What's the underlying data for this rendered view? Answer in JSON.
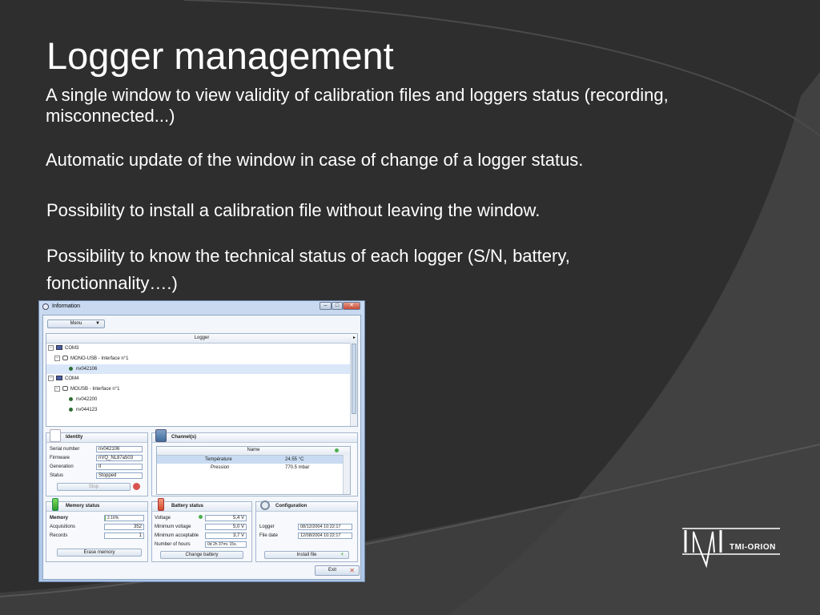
{
  "slide": {
    "title": "Logger management",
    "bullets": [
      "A single window to view validity of calibration files and loggers status (recording, misconnected...)",
      "Automatic update of the window in case of change of a logger status.",
      "Possibility to install a calibration file without leaving the window.",
      "Possibility to know the technical status of each logger (S/N, battery, fonctionnality….)"
    ]
  },
  "window": {
    "title": "Information",
    "controls": {
      "minimize": "–",
      "maximize": "□",
      "close": "✕"
    },
    "menu_label": "Menu",
    "logger_header": "Logger",
    "tree": [
      {
        "label": "COM3"
      },
      {
        "label": "MONO-USB - Interface n°1"
      },
      {
        "label": "nv042106"
      },
      {
        "label": "COM4"
      },
      {
        "label": "MOUSB - Interface n°1"
      },
      {
        "label": "nv042200"
      },
      {
        "label": "nv044123"
      }
    ],
    "identity": {
      "title": "Identity",
      "rows": [
        {
          "label": "Serial number",
          "value": "nv042106"
        },
        {
          "label": "Firmware",
          "value": "nVQ_NL87a503"
        },
        {
          "label": "Generation",
          "value": "II"
        },
        {
          "label": "Status",
          "value": "Stopped"
        }
      ],
      "stop_label": "Stop"
    },
    "channels": {
      "title": "Channel(s)",
      "column_header": "Name",
      "rows": [
        {
          "name": "Température",
          "value": "24.55 °C"
        },
        {
          "name": "Pression",
          "value": "770.5 mbar"
        }
      ]
    },
    "memory": {
      "title": "Memory status",
      "memory_label": "Memory",
      "memory_percent_text": "2.16%",
      "memory_fraction": 0.0216,
      "acquisitions_label": "Acquisitions",
      "acquisitions_value": "352",
      "records_label": "Records",
      "records_value": "1",
      "erase_label": "Erase memory"
    },
    "battery": {
      "title": "Battery status",
      "rows": [
        {
          "label": "Voltage",
          "value": "5,4 V"
        },
        {
          "label": "Minimum voltage",
          "value": "5,0 V"
        },
        {
          "label": "Minimum acceptable",
          "value": "3,7 V"
        },
        {
          "label": "Number of hours",
          "value": "0d 2h 37mi. 15s."
        }
      ],
      "change_label": "Change battery"
    },
    "configuration": {
      "title": "Configuration",
      "rows": [
        {
          "label": "Logger",
          "value": "08/12/2004 10:22:17"
        },
        {
          "label": "File date",
          "value": "12/08/2004 10:22:17"
        }
      ],
      "install_label": "Install file"
    },
    "exit_label": "Exit"
  },
  "brand": {
    "name": "TMI-ORION"
  },
  "colors": {
    "status_ok": "#2f6e35",
    "accent_green": "#3cb043",
    "close_red": "#c84b35"
  }
}
